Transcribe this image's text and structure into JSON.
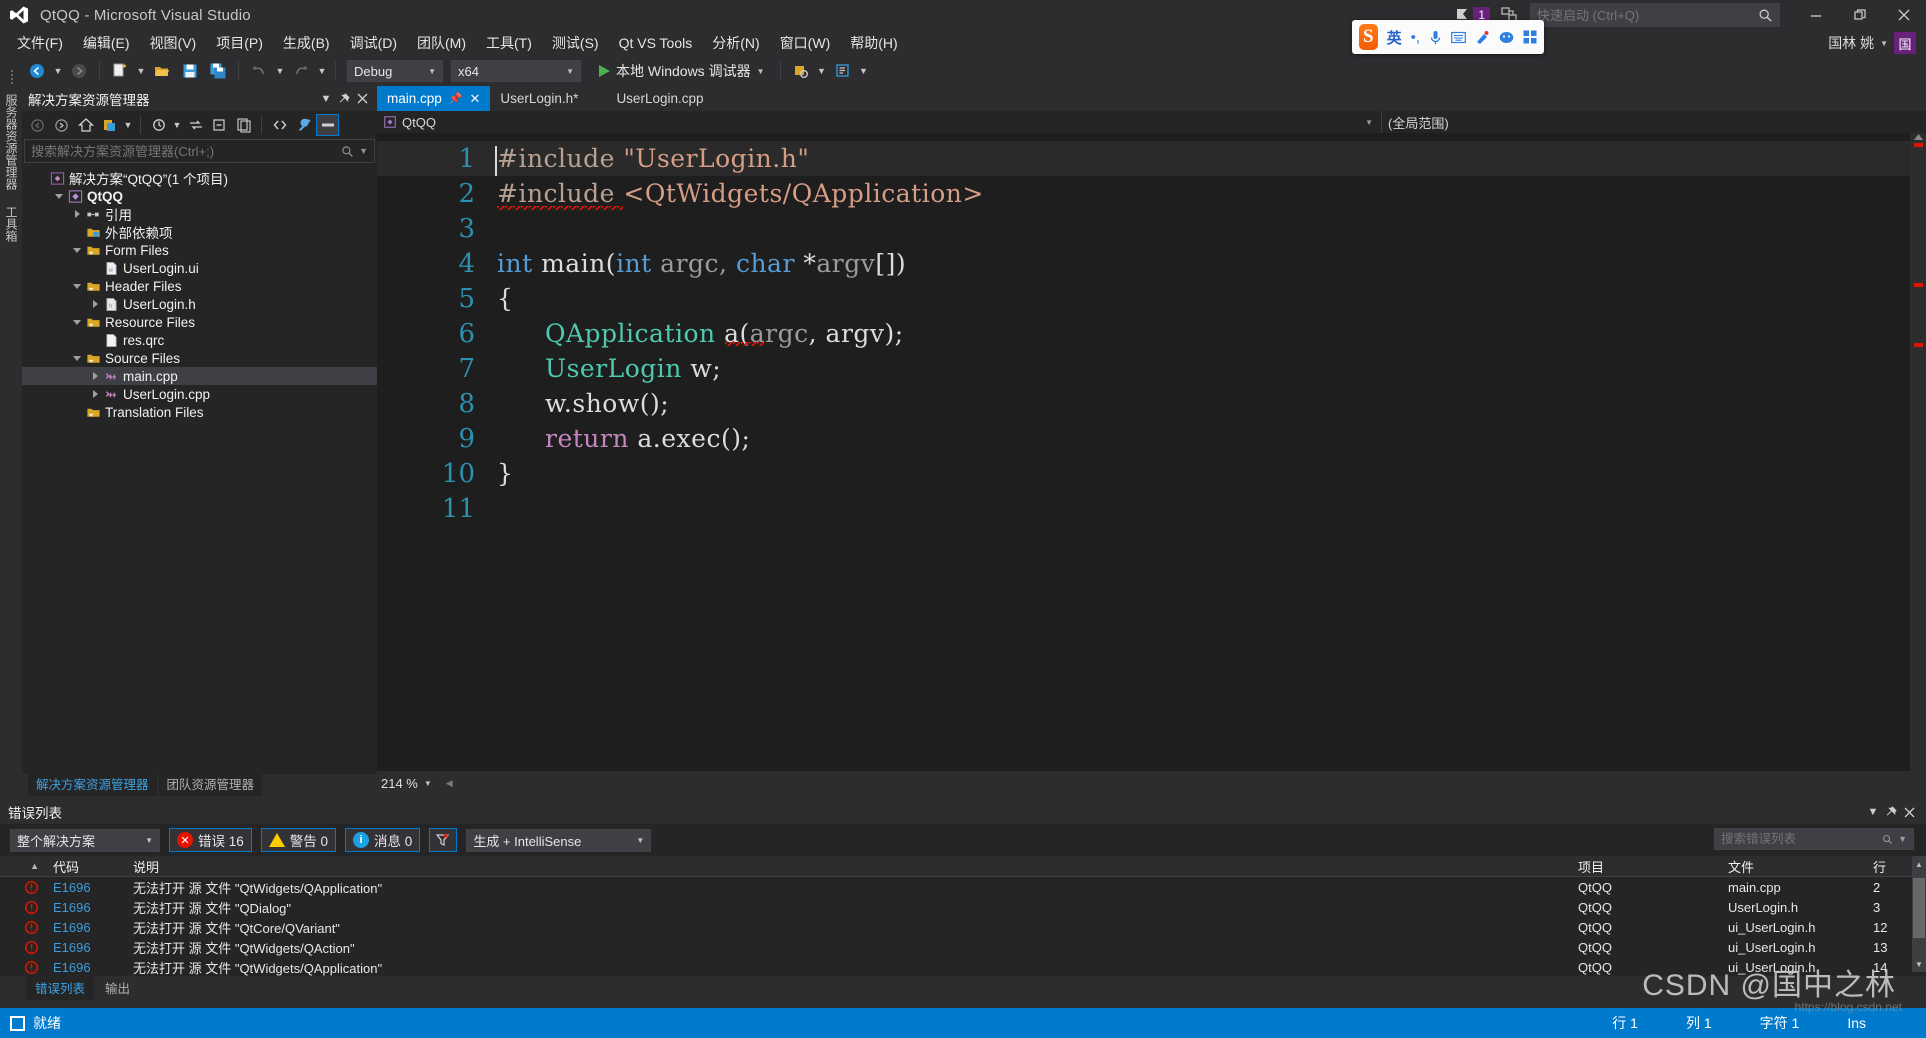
{
  "window": {
    "title": "QtQQ - Microsoft Visual Studio",
    "logo_icon": "visual-studio-logo",
    "minimize_label": "—",
    "restore_label": "❐",
    "close_label": "✕",
    "notification_count": "1",
    "user_name": "国林 姚",
    "user_initial": "国"
  },
  "quick_launch": {
    "placeholder": "快速启动 (Ctrl+Q)",
    "value": ""
  },
  "menu": {
    "items": [
      {
        "label": "文件(F)"
      },
      {
        "label": "编辑(E)"
      },
      {
        "label": "视图(V)"
      },
      {
        "label": "项目(P)"
      },
      {
        "label": "生成(B)"
      },
      {
        "label": "调试(D)"
      },
      {
        "label": "团队(M)"
      },
      {
        "label": "工具(T)"
      },
      {
        "label": "测试(S)"
      },
      {
        "label": "Qt VS Tools"
      },
      {
        "label": "分析(N)"
      },
      {
        "label": "窗口(W)"
      },
      {
        "label": "帮助(H)"
      }
    ]
  },
  "toolbar": {
    "back_icon": "navigate-back-icon",
    "forward_icon": "navigate-forward-icon",
    "new_project_icon": "new-project-icon",
    "open_file_icon": "open-file-icon",
    "save_icon": "save-icon",
    "save_all_icon": "save-all-icon",
    "undo_icon": "undo-icon",
    "redo_icon": "redo-icon",
    "configuration": "Debug",
    "platform": "x64",
    "run_label": "本地 Windows 调试器",
    "run_icon": "play-icon",
    "extra_icon_1": "attach-icon",
    "extra_icon_2": "step-icon"
  },
  "left_vtabs": [
    {
      "label": "服务器资源管理器"
    },
    {
      "label": "工具箱"
    }
  ],
  "solution_explorer": {
    "title": "解决方案资源管理器",
    "search_placeholder": "搜索解决方案资源管理器(Ctrl+;)",
    "toolbar_icons": [
      "navigate-back-icon",
      "navigate-forward-icon",
      "home-icon",
      "pending-changes-icon",
      "sync-icon",
      "refresh-icon",
      "collapse-all-icon",
      "show-all-files-icon",
      "show-code-icon",
      "properties-icon",
      "preview-icon"
    ],
    "tree": [
      {
        "indent": 0,
        "twisty": "none",
        "icon": "solution-icon",
        "label": "解决方案“QtQQ”(1 个项目)",
        "bold": false,
        "selected": false
      },
      {
        "indent": 1,
        "twisty": "down",
        "icon": "cpp-project-icon",
        "label": "QtQQ",
        "bold": true,
        "selected": false
      },
      {
        "indent": 2,
        "twisty": "right",
        "icon": "references-icon",
        "label": "引用",
        "bold": false,
        "selected": false
      },
      {
        "indent": 2,
        "twisty": "none",
        "icon": "ext-deps-icon",
        "label": "外部依赖项",
        "bold": false,
        "selected": false
      },
      {
        "indent": 2,
        "twisty": "down",
        "icon": "filter-folder-icon",
        "label": "Form Files",
        "bold": false,
        "selected": false
      },
      {
        "indent": 3,
        "twisty": "none",
        "icon": "ui-file-icon",
        "label": "UserLogin.ui",
        "bold": false,
        "selected": false
      },
      {
        "indent": 2,
        "twisty": "down",
        "icon": "filter-folder-icon",
        "label": "Header Files",
        "bold": false,
        "selected": false
      },
      {
        "indent": 3,
        "twisty": "right",
        "icon": "header-file-icon",
        "label": "UserLogin.h",
        "bold": false,
        "selected": false
      },
      {
        "indent": 2,
        "twisty": "down",
        "icon": "filter-folder-icon",
        "label": "Resource Files",
        "bold": false,
        "selected": false
      },
      {
        "indent": 3,
        "twisty": "none",
        "icon": "qrc-file-icon",
        "label": "res.qrc",
        "bold": false,
        "selected": false
      },
      {
        "indent": 2,
        "twisty": "down",
        "icon": "filter-folder-icon",
        "label": "Source Files",
        "bold": false,
        "selected": false
      },
      {
        "indent": 3,
        "twisty": "right",
        "icon": "cpp-file-icon",
        "label": "main.cpp",
        "bold": false,
        "selected": true
      },
      {
        "indent": 3,
        "twisty": "right",
        "icon": "cpp-file-icon",
        "label": "UserLogin.cpp",
        "bold": false,
        "selected": false
      },
      {
        "indent": 2,
        "twisty": "none",
        "icon": "filter-folder-icon",
        "label": "Translation Files",
        "bold": false,
        "selected": false
      }
    ],
    "footer_tabs": [
      {
        "label": "解决方案资源管理器",
        "active": true
      },
      {
        "label": "团队资源管理器",
        "active": false
      }
    ]
  },
  "editor": {
    "tabs": [
      {
        "label": "main.cpp",
        "active": true,
        "pinned": true,
        "closable": true
      },
      {
        "label": "UserLogin.h*",
        "active": false,
        "pinned": false,
        "closable": false
      },
      {
        "label": "UserLogin.cpp",
        "active": false,
        "pinned": false,
        "closable": false
      }
    ],
    "nav_project": "QtQQ",
    "nav_scope": "(全局范围)",
    "zoom_level": "214 %",
    "lines": [
      {
        "n": "1",
        "tokens": [
          {
            "t": "#include ",
            "c": "pre"
          },
          {
            "t": "\"UserLogin.h\"",
            "c": "str"
          }
        ],
        "indent": 0,
        "current": true,
        "squiggle": false
      },
      {
        "n": "2",
        "tokens": [
          {
            "t": "#include ",
            "c": "pre",
            "squiggle": true
          },
          {
            "t": "<QtWidgets/QApplication>",
            "c": "str"
          }
        ],
        "indent": 0,
        "current": false,
        "squiggle": false
      },
      {
        "n": "3",
        "tokens": [],
        "indent": 0,
        "current": false,
        "squiggle": false
      },
      {
        "n": "4",
        "tokens": [
          {
            "t": "int",
            "c": "kw"
          },
          {
            "t": " main(",
            "c": "pl2"
          },
          {
            "t": "int",
            "c": "kw"
          },
          {
            "t": " argc, ",
            "c": "pl"
          },
          {
            "t": "char",
            "c": "kw"
          },
          {
            "t": " *",
            "c": "pl2"
          },
          {
            "t": "argv",
            "c": "pl"
          },
          {
            "t": "[])",
            "c": "pl2"
          }
        ],
        "indent": 0,
        "current": false,
        "squiggle": false
      },
      {
        "n": "5",
        "tokens": [
          {
            "t": "{",
            "c": "pl2"
          }
        ],
        "indent": 0,
        "current": false,
        "squiggle": false
      },
      {
        "n": "6",
        "tokens": [
          {
            "t": "QApplication",
            "c": "typ"
          },
          {
            "t": " a(",
            "c": "pl2"
          },
          {
            "t": "argc",
            "c": "pl"
          },
          {
            "t": ", argv);",
            "c": "pl2"
          }
        ],
        "indent": 1,
        "current": false,
        "squiggle": true
      },
      {
        "n": "7",
        "tokens": [
          {
            "t": "UserLogin",
            "c": "typ"
          },
          {
            "t": " w;",
            "c": "pl2"
          }
        ],
        "indent": 1,
        "current": false,
        "squiggle": false
      },
      {
        "n": "8",
        "tokens": [
          {
            "t": "w.show();",
            "c": "pl2"
          }
        ],
        "indent": 1,
        "current": false,
        "squiggle": false
      },
      {
        "n": "9",
        "tokens": [
          {
            "t": "return",
            "c": "flowkw"
          },
          {
            "t": " a.exec();",
            "c": "pl2"
          }
        ],
        "indent": 1,
        "current": false,
        "squiggle": false
      },
      {
        "n": "10",
        "tokens": [
          {
            "t": "}",
            "c": "pl2"
          }
        ],
        "indent": 0,
        "current": false,
        "squiggle": false
      },
      {
        "n": "11",
        "tokens": [],
        "indent": 0,
        "current": false,
        "squiggle": false
      }
    ]
  },
  "error_list": {
    "title": "错误列表",
    "scope": "整个解决方案",
    "errors_label": "错误 16",
    "warnings_label": "警告 0",
    "messages_label": "消息 0",
    "filter_icon": "clear-filter-icon",
    "build_filter": "生成 + IntelliSense",
    "search_placeholder": "搜索错误列表",
    "columns": {
      "severity": "",
      "code": "代码",
      "description": "说明",
      "project": "项目",
      "file": "文件",
      "line": "行"
    },
    "rows": [
      {
        "severity": "error",
        "code": "E1696",
        "description": "无法打开 源 文件 \"QtWidgets/QApplication\"",
        "project": "QtQQ",
        "file": "main.cpp",
        "line": "2"
      },
      {
        "severity": "error",
        "code": "E1696",
        "description": "无法打开 源 文件 \"QDialog\"",
        "project": "QtQQ",
        "file": "UserLogin.h",
        "line": "3"
      },
      {
        "severity": "error",
        "code": "E1696",
        "description": "无法打开 源 文件 \"QtCore/QVariant\"",
        "project": "QtQQ",
        "file": "ui_UserLogin.h",
        "line": "12"
      },
      {
        "severity": "error",
        "code": "E1696",
        "description": "无法打开 源 文件 \"QtWidgets/QAction\"",
        "project": "QtQQ",
        "file": "ui_UserLogin.h",
        "line": "13"
      },
      {
        "severity": "error",
        "code": "E1696",
        "description": "无法打开 源 文件 \"QtWidgets/QApplication\"",
        "project": "QtQQ",
        "file": "ui_UserLogin.h",
        "line": "14"
      }
    ],
    "footer_tabs": [
      {
        "label": "错误列表",
        "active": true
      },
      {
        "label": "输出",
        "active": false
      }
    ]
  },
  "status_bar": {
    "ready": "就绪",
    "row": "行 1",
    "col": "列 1",
    "char": "字符 1",
    "insert_mode": "Ins"
  },
  "ime_bar": {
    "logo": "S",
    "mode": "英",
    "icons": [
      "punctuation-icon",
      "microphone-icon",
      "keyboard-icon",
      "skin-icon",
      "emoji-icon",
      "apps-icon"
    ]
  },
  "watermark": {
    "text": "CSDN @国中之林",
    "sub": "https://blog.csdn.net"
  },
  "colors": {
    "accent": "#007acc",
    "error": "#e51400",
    "warning": "#ffcc00",
    "info": "#1ba1e2",
    "purple": "#68217a",
    "editor_bg": "#1e1e1e",
    "panel_bg": "#252526",
    "chrome_bg": "#2d2d30"
  }
}
